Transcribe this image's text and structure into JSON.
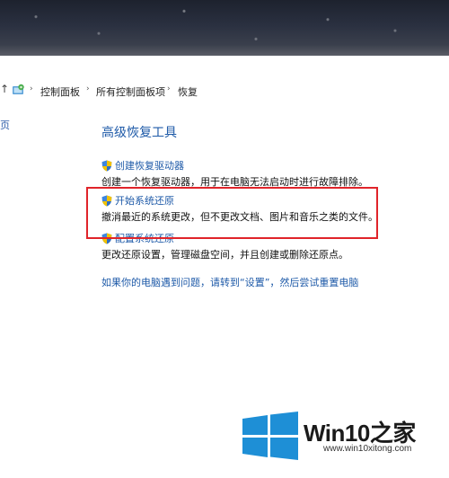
{
  "breadcrumb": {
    "items": [
      "控制面板",
      "所有控制面板项",
      "恢复"
    ]
  },
  "left_pane": {
    "fragment": "页"
  },
  "main": {
    "heading": "高级恢复工具",
    "tasks": [
      {
        "link": "创建恢复驱动器",
        "description": "创建一个恢复驱动器，用于在电脑无法启动时进行故障排除。"
      },
      {
        "link": "开始系统还原",
        "description": "撤消最近的系统更改，但不更改文档、图片和音乐之类的文件。"
      },
      {
        "link": "配置系统还原",
        "description": "更改还原设置，管理磁盘空间，并且创建或删除还原点。"
      }
    ],
    "reset_link": "如果你的电脑遇到问题，请转到“设置”，然后尝试重置电脑"
  },
  "watermark": {
    "brand": "Win10之家",
    "url": "www.win10xitong.com"
  },
  "colors": {
    "link_blue": "#1e5aa8",
    "highlight_red": "#e0242a",
    "win_blue": "#1e8fd6"
  },
  "icons": {
    "up_arrow": "up-arrow-icon",
    "control_panel": "control-panel-icon",
    "shield": "uac-shield-icon",
    "windows_logo": "windows-logo-icon"
  }
}
